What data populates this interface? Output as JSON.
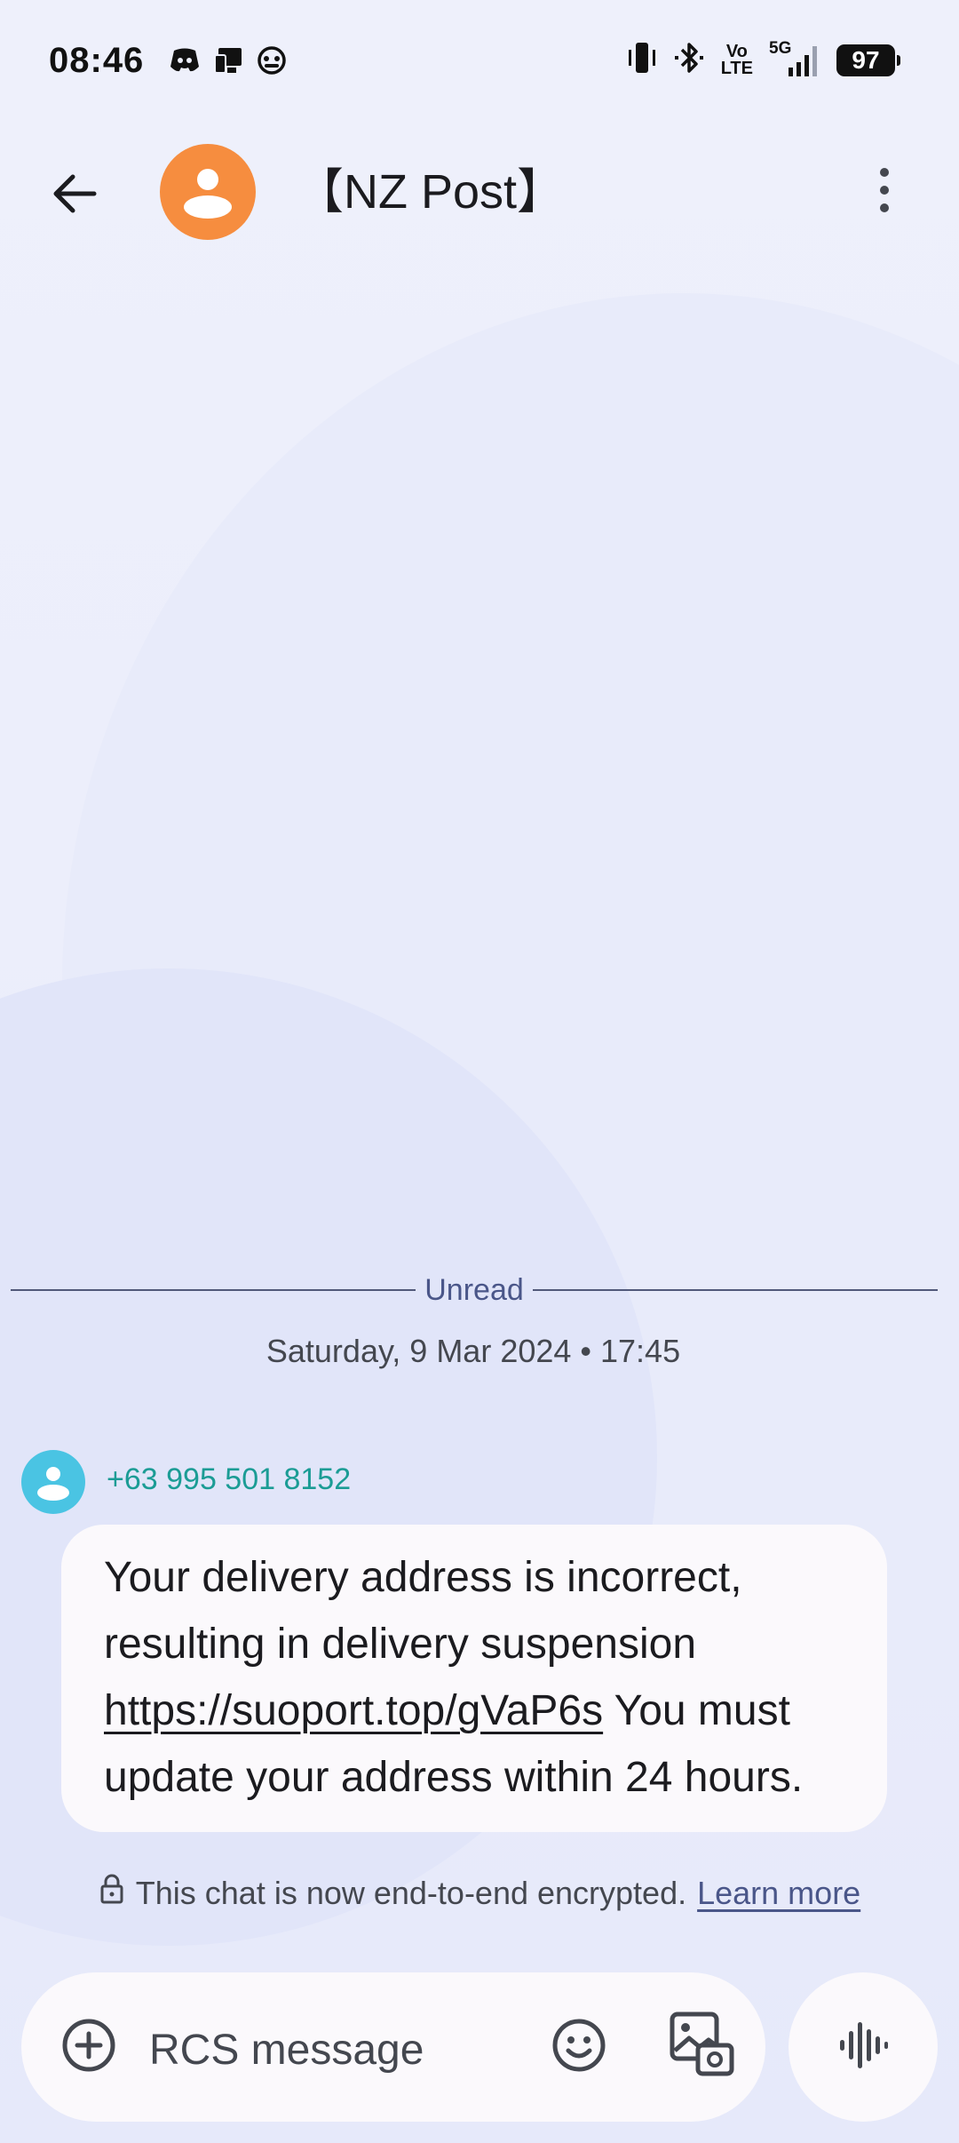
{
  "status_bar": {
    "time": "08:46",
    "battery": "97",
    "volte_top": "Vo",
    "volte_bottom": "LTE",
    "network": "5G",
    "left_icons": [
      "discord-icon",
      "cast-icon",
      "game-controller-icon"
    ],
    "right_icons": [
      "vibrate-icon",
      "bluetooth-icon",
      "volte-icon",
      "signal-5g-icon",
      "battery-icon"
    ]
  },
  "header": {
    "title": "【NZ Post】",
    "avatar_color": "#f68d3f",
    "icons": [
      "back-arrow-icon",
      "person-icon",
      "more-vert-icon"
    ]
  },
  "conversation": {
    "unread_label": "Unread",
    "date_label": "Saturday, 9 Mar 2024 • 17:45",
    "sender": {
      "number": "+63 995 501 8152",
      "avatar_color": "#4ac4e3"
    },
    "message": {
      "text_before": "Your delivery address is incorrect, resulting in delivery suspension ",
      "link": "https://suoport.top/gVaP6s",
      "text_after": " You must update your address within 24 hours."
    },
    "encryption_notice": "This chat is now end-to-end encrypted.",
    "learn_more": "Learn more"
  },
  "compose": {
    "placeholder": "RCS message",
    "icons": [
      "add-circle-icon",
      "emoji-icon",
      "gallery-icon",
      "voice-waveform-icon"
    ]
  },
  "colors": {
    "background": "#eceefb",
    "bubble": "#fbf9fc",
    "accent_teal": "#1b9c95",
    "divider": "#4a5689"
  }
}
